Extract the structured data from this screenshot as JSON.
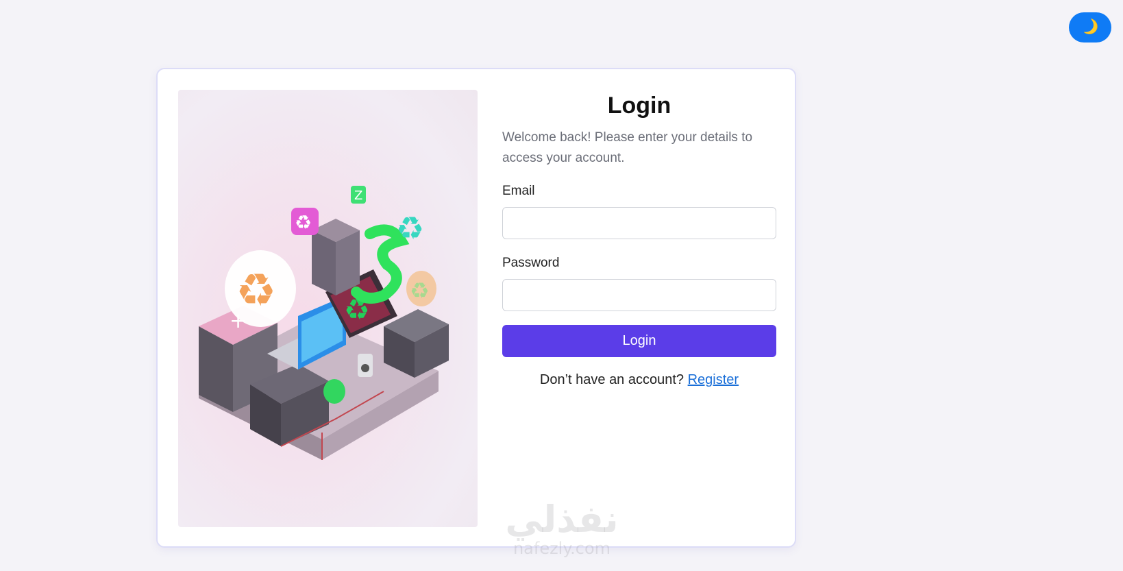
{
  "theme_toggle": {
    "icon": "moon-icon",
    "glyph": "🌙",
    "color": "#0f7bf5"
  },
  "illustration": {
    "icon": "recycling-electronics-illustration"
  },
  "login": {
    "title": "Login",
    "subtitle": "Welcome back! Please enter your details to access your account.",
    "email_label": "Email",
    "email_value": "",
    "password_label": "Password",
    "password_value": "",
    "button_label": "Login",
    "button_color": "#5b3de8",
    "no_account_text": "Don’t have an account?",
    "register_link": "Register"
  },
  "watermark": {
    "arabic": "نفذلي",
    "latin": "nafezly.com"
  }
}
